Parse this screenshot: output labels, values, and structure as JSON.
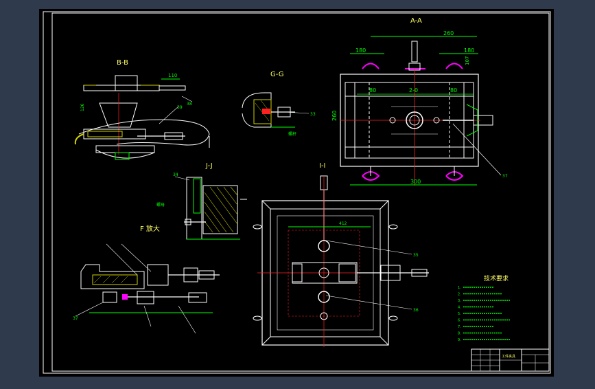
{
  "drawing": {
    "views": {
      "bb": "B-B",
      "gg": "G-G",
      "aa": "A-A",
      "jj": "J-J",
      "ii": "I-I",
      "f_detail": "F 放大"
    },
    "dims": {
      "aa_top_total": "260",
      "aa_top_left": "180",
      "aa_top_right": "180",
      "aa_vertical": "107",
      "aa_inner_left": "80",
      "aa_inner_mid": "2-0",
      "aa_inner_right": "80",
      "aa_height": "260",
      "aa_bottom": "300",
      "bb_top": "110",
      "ii_inner": "412"
    },
    "notes": {
      "title": "技术要求",
      "items": [
        "1.",
        "2.",
        "3.",
        "4.",
        "5.",
        "6.",
        "7.",
        "8.",
        "9."
      ]
    },
    "title_block": {
      "name": "工件夹具"
    }
  },
  "colors": {
    "paper": "#000000",
    "outer_bg": "#2f3a4c",
    "line": "#ffffff",
    "dim": "#00ff00",
    "center": "#ff2020",
    "hatch": "#d0d000",
    "label": "#ffff66",
    "accent": "#ff00ff",
    "cyan": "#00ffff"
  }
}
